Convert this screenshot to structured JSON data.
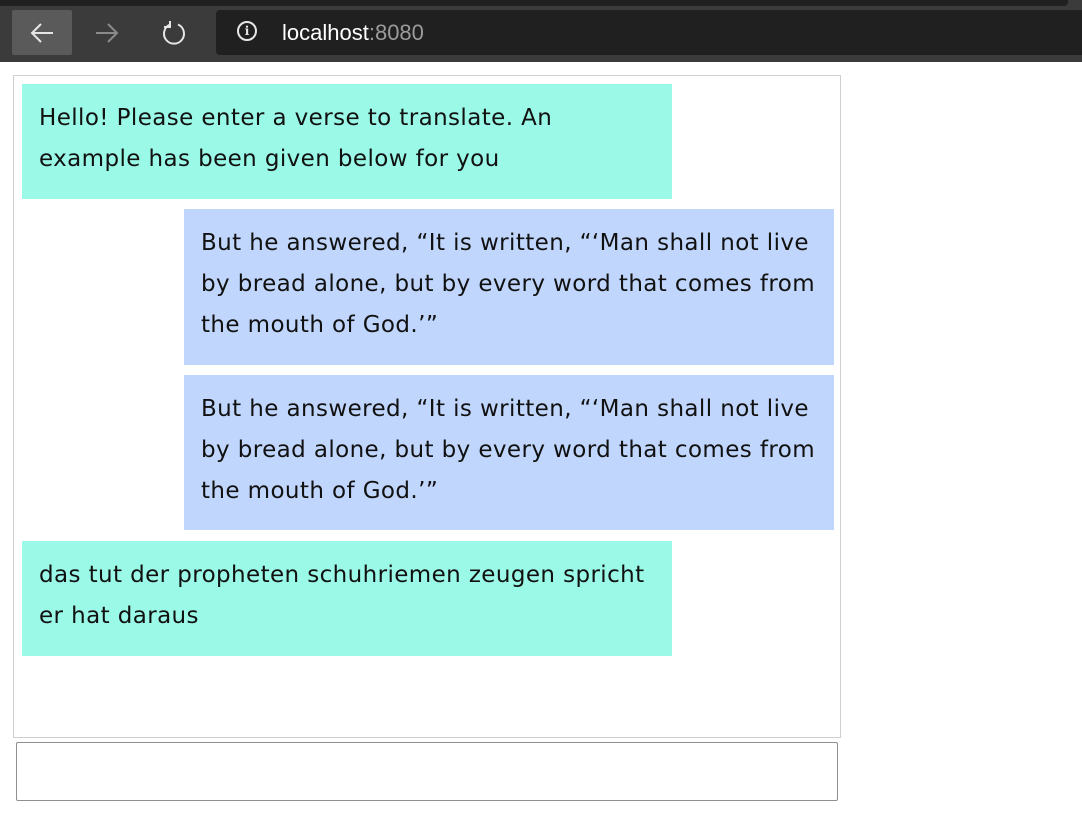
{
  "browser": {
    "url_host": "localhost",
    "url_port": ":8080",
    "back_icon": "arrow-left-icon",
    "forward_icon": "arrow-right-icon",
    "refresh_icon": "refresh-icon",
    "info_icon": "info-icon"
  },
  "chat": {
    "messages": [
      {
        "sender": "bot",
        "text": "Hello! Please enter a verse to translate. An example has been given below for you"
      },
      {
        "sender": "user",
        "text": "But he answered, “It is written, “‘Man shall not live by bread alone, but by every word that comes from the mouth of God.’”"
      },
      {
        "sender": "user",
        "text": "But he answered, “It is written, “‘Man shall not live by bread alone, but by every word that comes from the mouth of God.’”"
      },
      {
        "sender": "bot",
        "text": "das tut der propheten schuhriemen zeugen spricht er hat daraus"
      }
    ]
  },
  "input": {
    "value": "",
    "placeholder": ""
  },
  "colors": {
    "bot_bubble": "#9bf9e7",
    "user_bubble": "#c0d6fc",
    "browser_bar": "#3b3b3b",
    "address_bar": "#202020"
  }
}
